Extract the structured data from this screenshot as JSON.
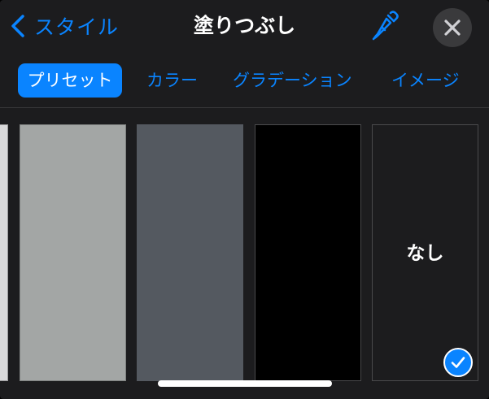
{
  "header": {
    "back_label": "スタイル",
    "title": "塗りつぶし",
    "eyedropper_icon": "eyedropper-icon",
    "close_icon": "close-icon"
  },
  "tabs": [
    {
      "label": "プリセット",
      "active": true
    },
    {
      "label": "カラー",
      "active": false
    },
    {
      "label": "グラデーション",
      "active": false
    },
    {
      "label": "イメージ",
      "active": false
    }
  ],
  "swatches": [
    {
      "color": "#d9d9db"
    },
    {
      "color": "#a3a6a5"
    },
    {
      "color": "#545960"
    },
    {
      "color": "#000000"
    },
    {
      "label": "なし",
      "selected": true
    }
  ],
  "colors": {
    "accent": "#0a84ff",
    "panel_bg": "#1c1c1e",
    "close_bg": "#3a3a3c"
  }
}
